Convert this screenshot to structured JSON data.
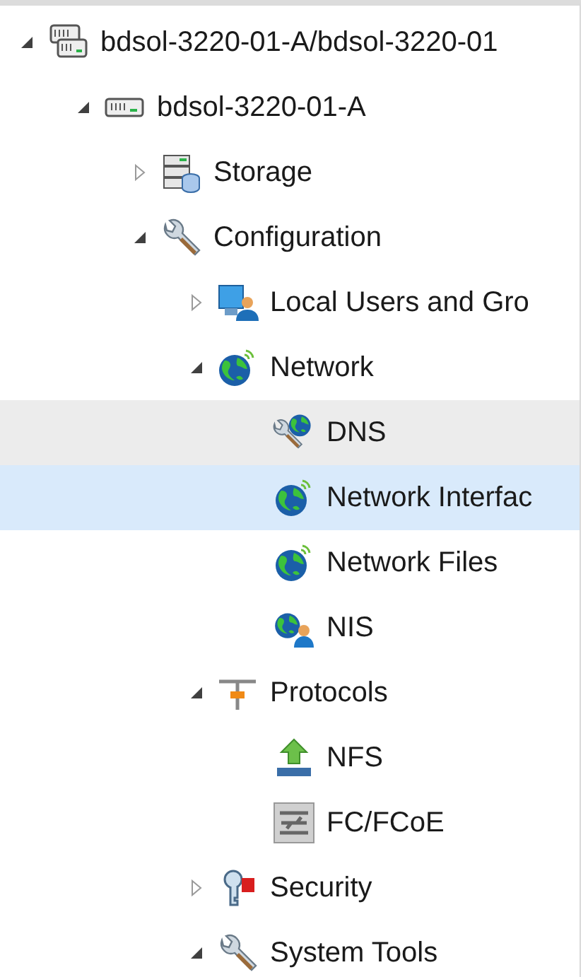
{
  "tree": [
    {
      "label": "bdsol-3220-01-A/bdsol-3220-01",
      "kind": "cluster",
      "expanded": true,
      "selected": false,
      "hovered": false,
      "children": [
        {
          "label": "bdsol-3220-01-A",
          "kind": "node",
          "expanded": true,
          "selected": false,
          "hovered": false,
          "children": [
            {
              "label": "Storage",
              "kind": "storage",
              "expanded": false,
              "selected": false,
              "hovered": false
            },
            {
              "label": "Configuration",
              "kind": "wrench",
              "expanded": true,
              "selected": false,
              "hovered": false,
              "children": [
                {
                  "label": "Local Users and Gro",
                  "kind": "users",
                  "expanded": false,
                  "selected": false,
                  "hovered": false
                },
                {
                  "label": "Network",
                  "kind": "globe",
                  "expanded": true,
                  "selected": false,
                  "hovered": false,
                  "children": [
                    {
                      "label": "DNS",
                      "kind": "dns",
                      "selected": false,
                      "hovered": true
                    },
                    {
                      "label": "Network Interfac",
                      "kind": "globe",
                      "selected": true,
                      "hovered": false
                    },
                    {
                      "label": "Network Files",
                      "kind": "globe",
                      "selected": false,
                      "hovered": false
                    },
                    {
                      "label": "NIS",
                      "kind": "nis",
                      "selected": false,
                      "hovered": false
                    }
                  ]
                },
                {
                  "label": "Protocols",
                  "kind": "protocols",
                  "expanded": true,
                  "selected": false,
                  "hovered": false,
                  "children": [
                    {
                      "label": "NFS",
                      "kind": "nfs",
                      "selected": false,
                      "hovered": false
                    },
                    {
                      "label": "FC/FCoE",
                      "kind": "fc",
                      "selected": false,
                      "hovered": false
                    }
                  ]
                },
                {
                  "label": "Security",
                  "kind": "security",
                  "expanded": false,
                  "selected": false,
                  "hovered": false
                },
                {
                  "label": "System Tools",
                  "kind": "wrench",
                  "expanded": true,
                  "selected": false,
                  "hovered": false
                }
              ]
            }
          ]
        }
      ]
    }
  ]
}
